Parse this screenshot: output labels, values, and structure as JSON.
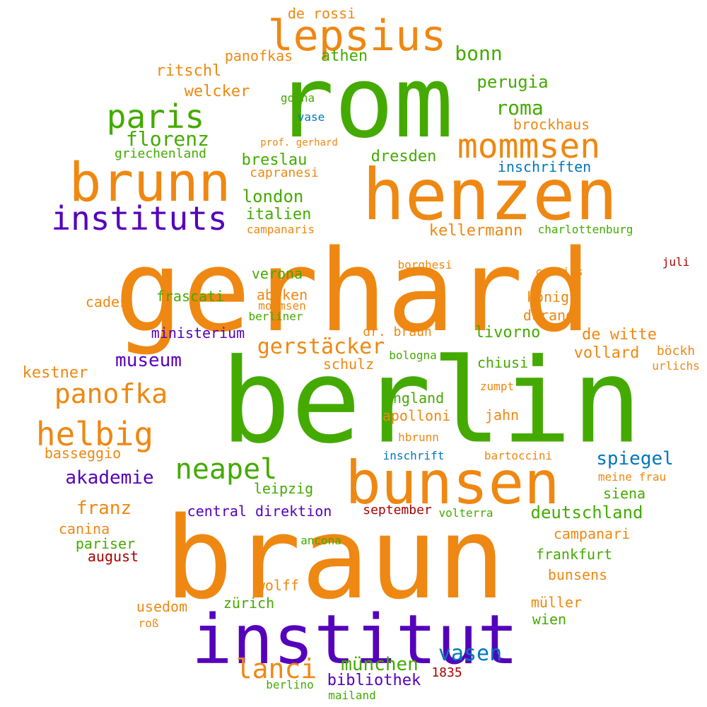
{
  "palette": {
    "orange": "#ee8812",
    "green": "#44aa00",
    "purple": "#5500bb",
    "blue": "#0077bb",
    "red": "#aa0000"
  },
  "words": [
    "gerhard",
    "berlin",
    "braun",
    "rom",
    "henzen",
    "institut",
    "bunsen",
    "brunn",
    "lepsius",
    "mommsen",
    "instituts",
    "paris",
    "helbig",
    "panofka",
    "neapel",
    "lanci",
    "gerstäcker",
    "bonn",
    "roma",
    "florenz",
    "perugia",
    "vasen",
    "spiegel",
    "akademie",
    "museum",
    "münchen",
    "franz",
    "deutschland",
    "london",
    "breslau",
    "dresden",
    "ritschl",
    "welcker",
    "athen",
    "panofkas",
    "de rossi",
    "brockhaus",
    "inschriften",
    "griechenland",
    "kellermann",
    "italien",
    "de witte",
    "vollard",
    "livorno",
    "könig",
    "ministerium",
    "central direktion",
    "kestner",
    "schulz",
    "chiusi",
    "leipzig",
    "england",
    "apolloni",
    "jahn",
    "siena",
    "campanari",
    "frankfurt",
    "bunsens",
    "basseggio",
    "canina",
    "pariser",
    "abeken",
    "verona",
    "frascati",
    "cades",
    "mommsen",
    "berliner",
    "durand",
    "dr. braun",
    "bologna",
    "böckh",
    "urlichs",
    "zumpt",
    "hbrunn",
    "inschrift",
    "bartoccini",
    "meine frau",
    "september",
    "volterra",
    "august",
    "ancona",
    "wolff",
    "usedom",
    "zürich",
    "müller",
    "wien",
    "roß",
    "bibliothek",
    "berlino",
    "mailand",
    "1835",
    "gotha",
    "vase",
    "prof. gerhard",
    "capranesi",
    "campanaris",
    "charlottenburg",
    "borghesi",
    "curtius",
    "juli"
  ]
}
